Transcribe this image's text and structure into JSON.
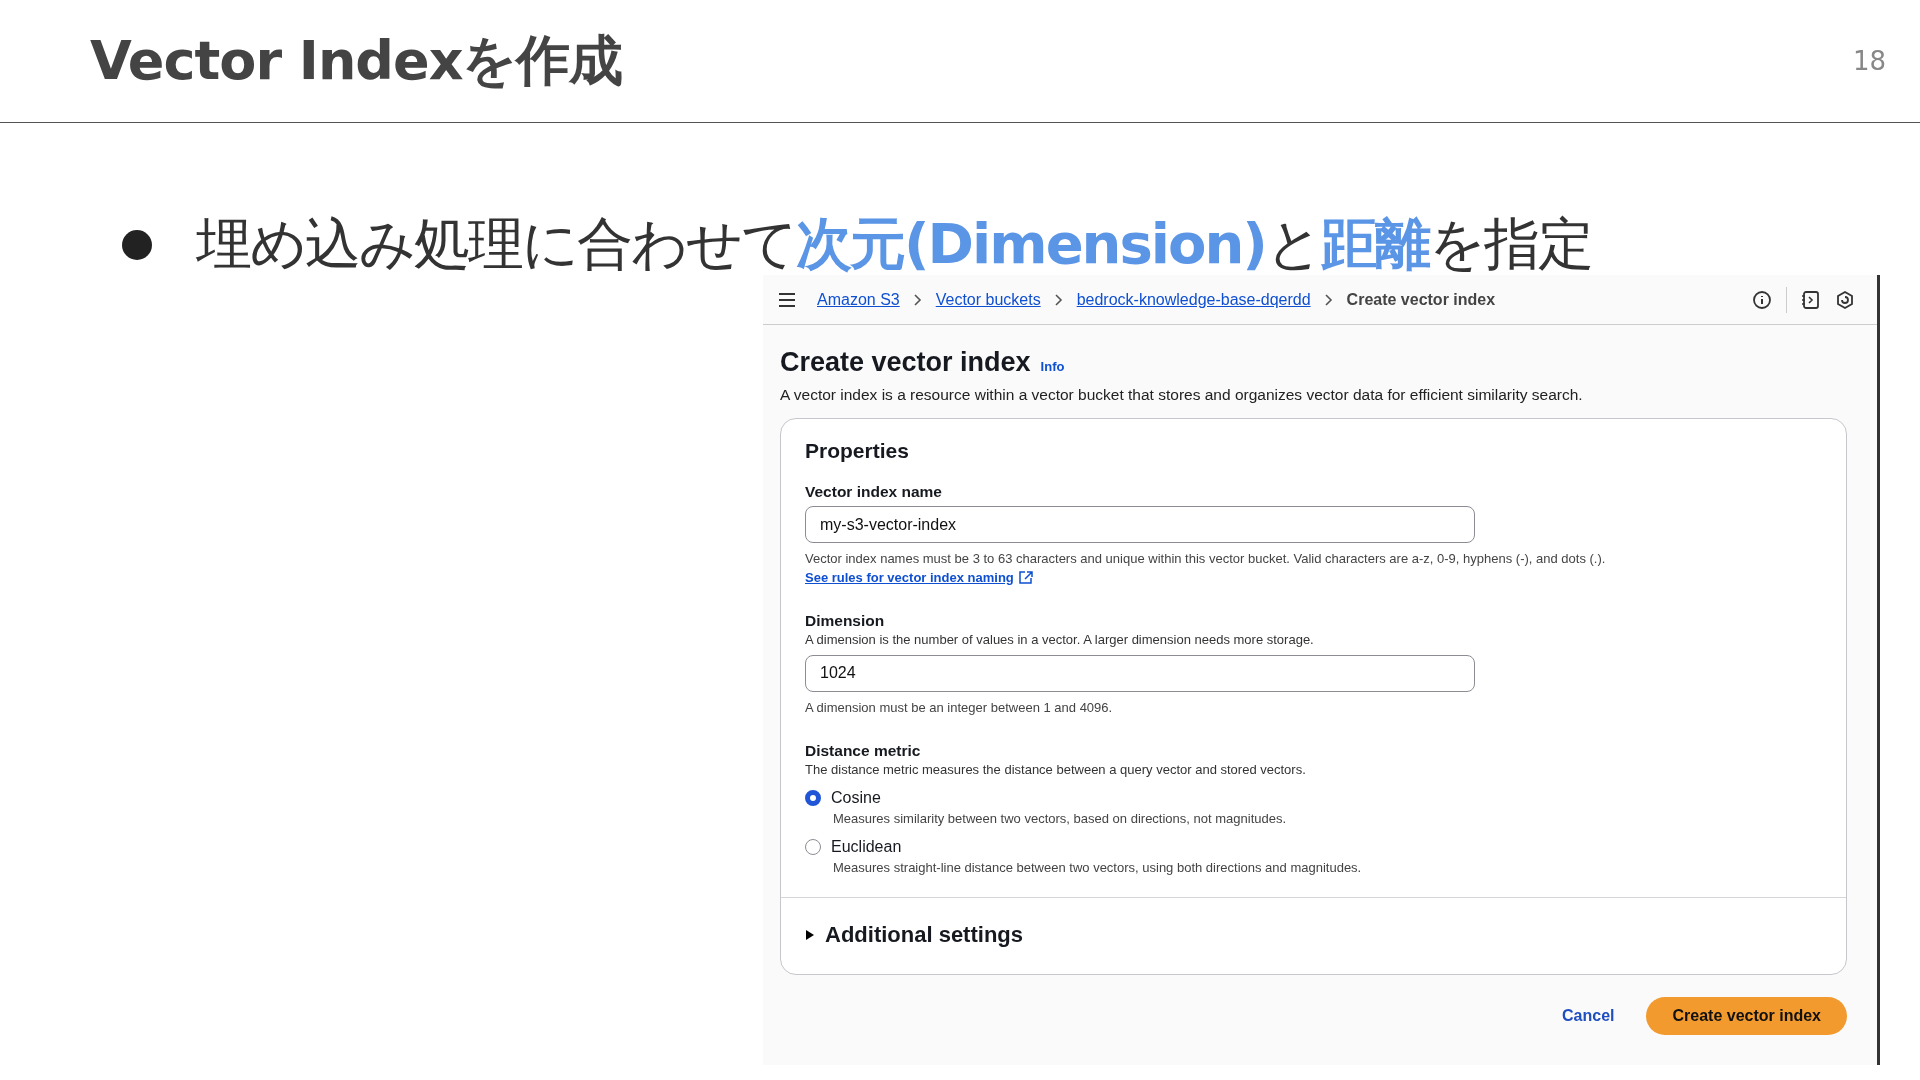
{
  "slide": {
    "title": "Vector Indexを作成",
    "page_number": "18",
    "bullet": [
      {
        "text": "埋め込み処理に合わせて",
        "highlight": false
      },
      {
        "text": "次元(Dimension)",
        "highlight": true
      },
      {
        "text": "と",
        "highlight": false
      },
      {
        "text": "距離",
        "highlight": true
      },
      {
        "text": "を指定",
        "highlight": false
      }
    ]
  },
  "console": {
    "breadcrumbs": [
      {
        "label": "Amazon S3",
        "link": true
      },
      {
        "label": "Vector buckets",
        "link": true
      },
      {
        "label": "bedrock-knowledge-base-dqerdd",
        "link": true
      },
      {
        "label": "Create vector index",
        "link": false
      }
    ],
    "page_title": "Create vector index",
    "info_link": "Info",
    "description": "A vector index is a resource within a vector bucket that stores and organizes vector data for efficient similarity search.",
    "properties": {
      "title": "Properties",
      "index_name": {
        "label": "Vector index name",
        "value": "my-s3-vector-index",
        "help": "Vector index names must be 3 to 63 characters and unique within this vector bucket. Valid characters are a-z, 0-9, hyphens (-), and dots (.).",
        "help_link": "See rules for vector index naming"
      },
      "dimension": {
        "label": "Dimension",
        "description": "A dimension is the number of values in a vector. A larger dimension needs more storage.",
        "value": "1024",
        "help": "A dimension must be an integer between 1 and 4096."
      },
      "distance_metric": {
        "label": "Distance metric",
        "description": "The distance metric measures the distance between a query vector and stored vectors.",
        "options": [
          {
            "label": "Cosine",
            "description": "Measures similarity between two vectors, based on directions, not magnitudes.",
            "selected": true
          },
          {
            "label": "Euclidean",
            "description": "Measures straight-line distance between two vectors, using both directions and magnitudes.",
            "selected": false
          }
        ]
      },
      "additional_settings": {
        "label": "Additional settings",
        "expanded": false
      }
    },
    "buttons": {
      "cancel": "Cancel",
      "submit": "Create vector index"
    }
  }
}
